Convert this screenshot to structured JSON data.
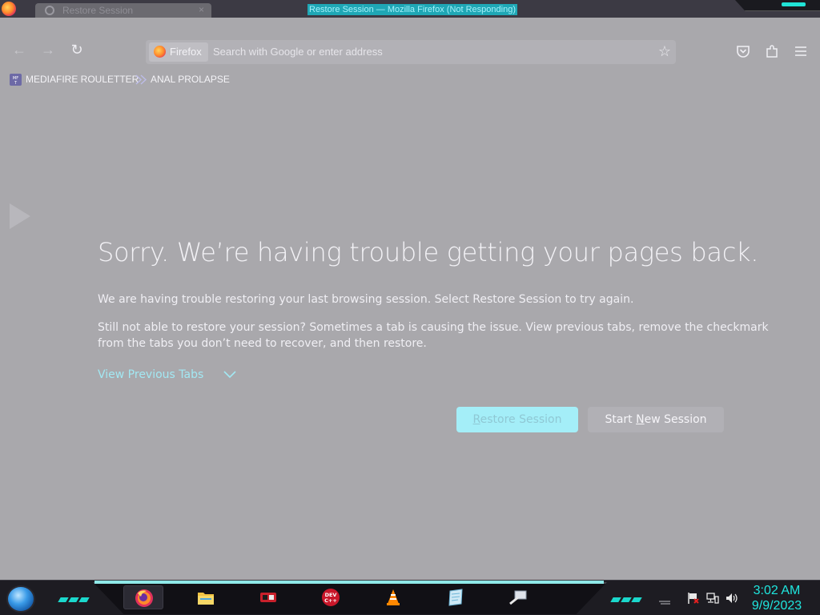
{
  "window": {
    "title": "Restore Session — Mozilla Firefox (Not Responding)",
    "tab_title": "Restore Session",
    "tab_close": "×"
  },
  "toolbar": {
    "identity_label": "Firefox",
    "url_placeholder": "Search with Google or enter address"
  },
  "bookmarks": [
    {
      "label": "MEDIAFIRE ROULETTER",
      "icon": "mediafire-icon"
    },
    {
      "label": "ANAL PROLAPSE",
      "icon": "bookmark-favicon"
    }
  ],
  "content": {
    "heading": "Sorry. We’re having trouble getting your pages back.",
    "para1": "We are having trouble restoring your last browsing session. Select Restore Session to try again.",
    "para2_line1": "Still not able to restore your session? Sometimes a tab is causing the issue. View previous tabs, remove the checkmark",
    "para2_line2": "from the tabs you don’t need to recover, and then restore.",
    "view_previous_tabs": "View Previous Tabs",
    "restore_button": {
      "prefix": "",
      "underline": "R",
      "rest": "estore Session"
    },
    "new_session_button": {
      "prefix": "Start ",
      "underline": "N",
      "rest": "ew Session"
    }
  },
  "taskbar": {
    "apps": [
      "firefox-icon",
      "file-explorer-icon",
      "media-app-icon",
      "devcpp-icon",
      "vlc-icon",
      "notepad-icon",
      "remote-app-icon"
    ],
    "clock_time": "3:02 AM",
    "clock_date": "9/9/2023",
    "devcpp_label": "DEV C++"
  },
  "colors": {
    "accent": "#1fe6de",
    "background": "#a9a8ac",
    "restore_button_bg": "#a4eef8",
    "link": "#a2e8f3"
  }
}
